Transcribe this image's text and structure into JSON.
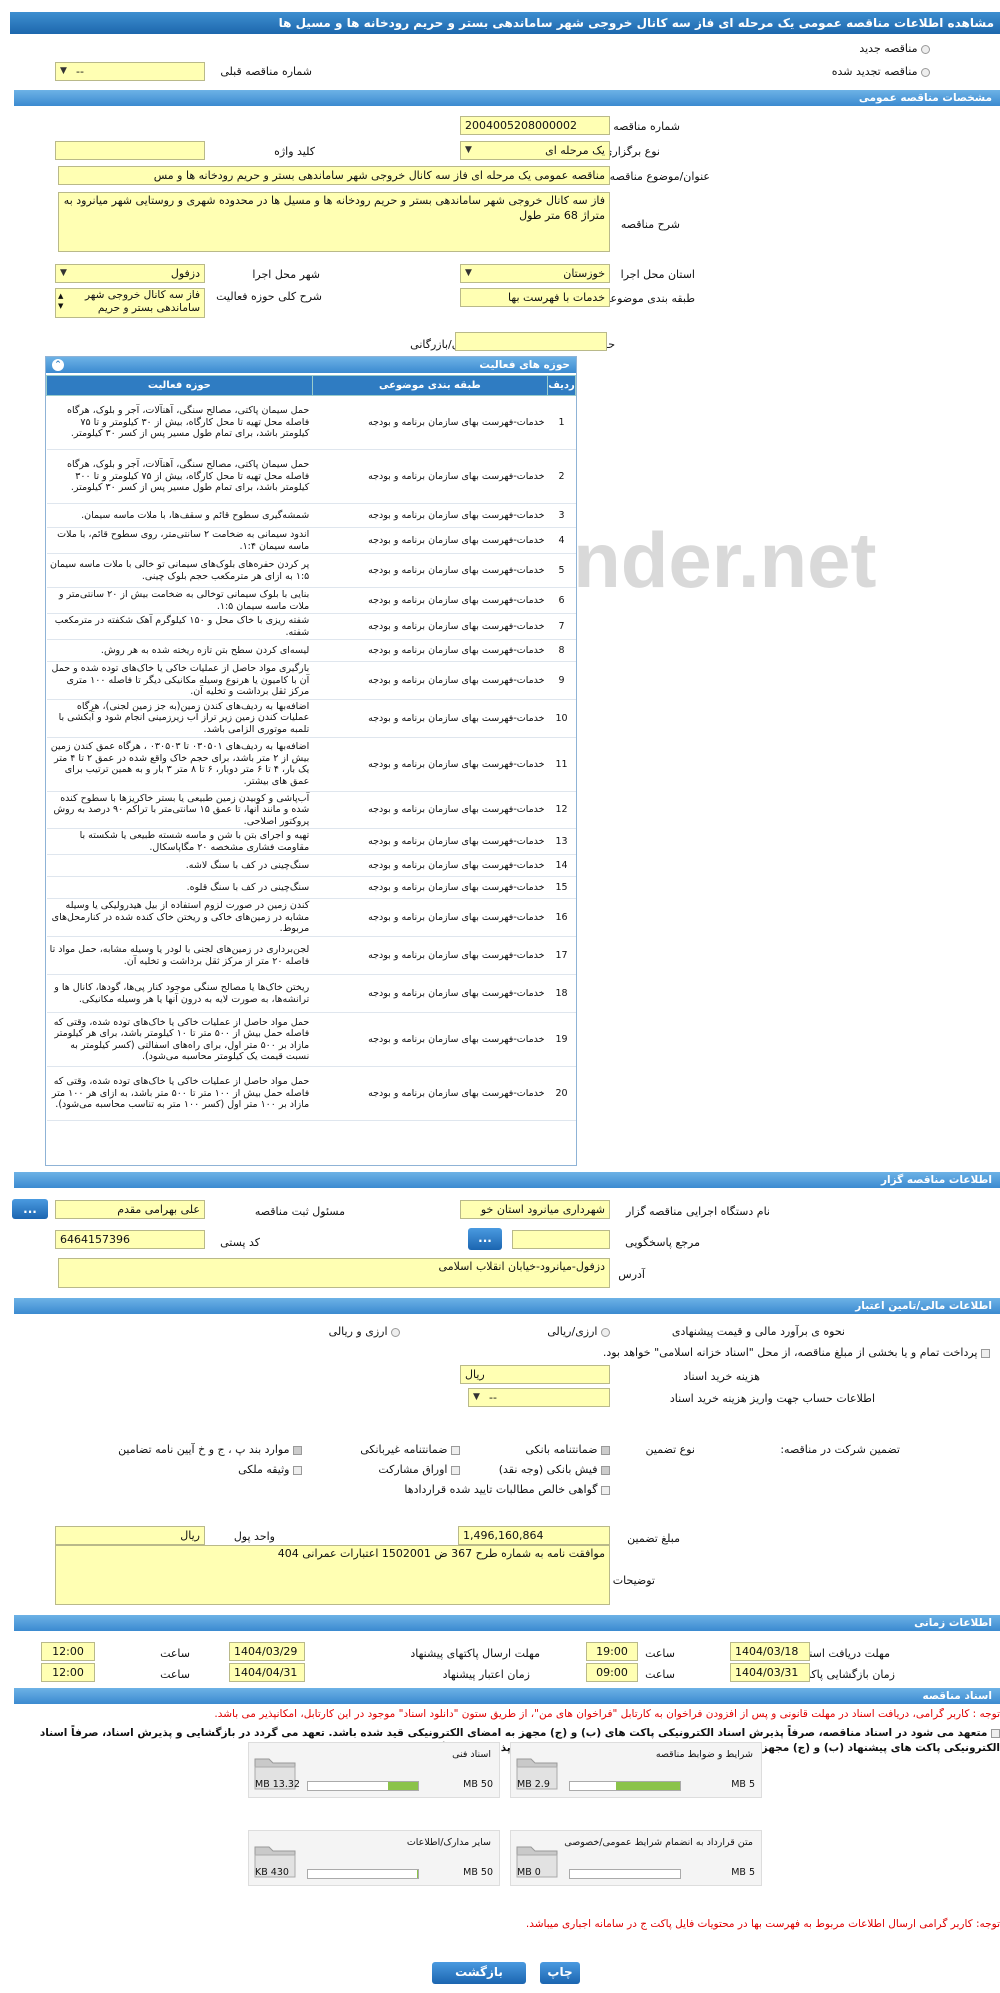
{
  "page": {
    "title": "مشاهده اطلاعات مناقصه عمومی یک مرحله ای فاز سه کانال خروجی شهر ساماندهی بستر و حریم رودخانه ها و مسیل ها"
  },
  "type_section": {
    "new": "مناقصه جدید",
    "renew": "مناقصه تجدید شده",
    "prev_number_label": "شماره مناقصه قبلی",
    "prev_number_value": "--"
  },
  "general": {
    "header": "مشخصات مناقصه عمومی",
    "number_label": "شماره مناقصه",
    "number": "2004005208000002",
    "hold_type_label": "نوع برگزاری",
    "hold_type": "یک مرحله ای",
    "keyword_label": "کلید واژه",
    "keyword": "",
    "subject_label": "عنوان/موضوع مناقصه",
    "subject": "مناقصه عمومی یک مرحله ای فاز سه کانال خروجی شهر ساماندهی بستر و حریم رودخانه ها و مس",
    "desc_label": "شرح مناقصه",
    "desc": "فاز سه کانال خروجی شهر ساماندهی بستر و حریم رودخانه ها و مسیل ها در محدوده شهری و روستایی شهر میانرود به متراژ 68 متر طول",
    "province_label": "استان محل اجرا",
    "province": "خوزستان",
    "city_label": "شهر محل اجرا",
    "city": "دزفول",
    "category_label": "طبقه بندی موضوعی",
    "category": "خدمات با فهرست بها",
    "activity_desc_label": "شرح کلی حوزه فعالیت",
    "activity_desc": "فاز سه کانال خروجی شهر ساماندهی بستر و حریم",
    "min_score_label": "حداقل امتیاز قابل قبول ارزیابی فنی/بازرگانی",
    "min_score": ""
  },
  "activities": {
    "header": "حوزه های فعالیت",
    "col_no": "ردیف",
    "col_cat": "طبقه بندی موضوعی",
    "col_act": "حوزه فعالیت",
    "cat": "خدمات-فهرست بهای سازمان برنامه و بودجه",
    "rows": [
      {
        "n": "1",
        "d": "حمل سیمان پاکتی، مصالح سنگی، آهنآلات، آجر و بلوک، هرگاه فاصله محل تهیه تا محل کارگاه، بیش از ۳۰ کیلومتر و تا ۷۵ کیلومتر باشد، برای تمام طول مسیر پس از کسر ۳۰ کیلومتر."
      },
      {
        "n": "2",
        "d": "حمل سیمان پاکتی، مصالح سنگی، آهنآلات، آجر و بلوک، هرگاه فاصله محل تهیه تا محل کارگاه، بیش از ۷۵ کیلومتر و تا ۳۰۰ کیلومتر باشد، برای تمام طول مسیر پس از کسر ۳۰ کیلومتر."
      },
      {
        "n": "3",
        "d": "شمشه‌گیری سطوح قائم و سقف‌ها، با ملات ماسه سیمان."
      },
      {
        "n": "4",
        "d": "اندود سیمانی به ضخامت ۲ سانتی‌متر، روی سطوح قائم، با ملات ماسه سیمان ۱:۴."
      },
      {
        "n": "5",
        "d": "پر کردن حفره‌های بلوک‌های سیمانی تو خالی با ملات ماسه سیمان ۱:۵ به ازای هر مترمکعب حجم بلوک چینی."
      },
      {
        "n": "6",
        "d": "بنایی با بلوک سیمانی توخالی به ضخامت بیش از ۲۰ سانتی‌متر و ملات ماسه سیمان ۱:۵."
      },
      {
        "n": "7",
        "d": "شفته ریزی با خاک محل و ۱۵۰ کیلوگرم آهک شکفته در مترمکعب شفته."
      },
      {
        "n": "8",
        "d": "لیسه‌ای کردن سطح بتن تازه ریخته شده به هر روش."
      },
      {
        "n": "9",
        "d": "بارگیری مواد حاصل از عملیات خاکی یا خاک‌های توده شده و حمل آن با کامیون یا هرنوع وسیله مکانیکی دیگر تا فاصله ۱۰۰ متری مرکز ثقل برداشت و تخلیه آن."
      },
      {
        "n": "10",
        "d": "اضافه‌بها به ردیف‌های کندن زمین(به جز زمین لجنی)، هرگاه عملیات کندن زمین زیر تراز آب زیرزمینی انجام شود و آبکشی با تلمبه موتوری الزامی باشد."
      },
      {
        "n": "11",
        "d": "اضافه‌بها به ردیف‌های ۰۳۰۵۰۱ تا ۰۳۰۵۰۳ ، هرگاه عمق کندن زمین بیش از ۲ متر باشد، برای حجم خاک واقع شده در عمق ۲ تا ۴ متر یک بار، ۴ تا ۶ متر دوبار، ۶ تا ۸ متر ۳ بار و به همین ترتیب برای عمق های بیشتر."
      },
      {
        "n": "12",
        "d": "آب‌پاشی و کوبیدن زمین طبیعی یا بستر خاکریزها با سطوح کنده شده و مانند آنها، تا عمق ۱۵ سانتی‌متر با تراکم ۹۰ درصد به روش پروکتور اصلاحی."
      },
      {
        "n": "13",
        "d": "تهیه و اجرای بتن با شن و ماسه شسته طبیعی یا شکسته با مقاومت فشاری مشخصه ۲۰ مگاپاسکال."
      },
      {
        "n": "14",
        "d": "سنگ‌چینی در کف با سنگ لاشه."
      },
      {
        "n": "15",
        "d": "سنگ‌چینی در کف با سنگ قلوه."
      },
      {
        "n": "16",
        "d": "کندن زمین در صورت لزوم استفاده از بیل هیدرولیکی یا وسیله مشابه در زمین‌های خاکی و ریختن خاک کنده شده در کنارمحل‌های مربوط."
      },
      {
        "n": "17",
        "d": "لجن‌برداری در زمین‌های لجنی با لودر یا وسیله مشابه، حمل مواد تا فاصله ۲۰ متر از مرکز ثقل برداشت و تخلیه آن."
      },
      {
        "n": "18",
        "d": "ریختن خاک‌ها یا مصالح سنگی موجود کنار پی‌ها، گودها، کانال ها و ترانشه‌ها، به صورت لایه به درون آنها یا هر وسیله مکانیکی."
      },
      {
        "n": "19",
        "d": "حمل مواد حاصل از عملیات خاکی یا خاک‌های توده شده، وقتی که فاصله حمل بیش از ۵۰۰ متر تا ۱۰ کیلومتر باشد، برای هر کیلومتر مازاد بر ۵۰۰ متر اول، برای راه‌های اسفالتی (کسر کیلومتر به نسبت قیمت یک کیلومتر محاسبه می‌شود)."
      },
      {
        "n": "20",
        "d": "حمل مواد حاصل از عملیات خاکی یا خاک‌های توده شده، وقتی که فاصله حمل بیش از ۱۰۰ متر تا ۵۰۰ متر باشد، به ازای هر ۱۰۰ متر مازاد بر ۱۰۰ متر اول (کسر ۱۰۰ متر به تناسب محاسبه می‌شود)."
      }
    ]
  },
  "tenderer": {
    "header": "اطلاعات مناقصه گزار",
    "org_label": "نام دستگاه اجرایی مناقصه گزار",
    "org": "شهرداری میانرود استان خو",
    "resp_label": "مسئول ثبت مناقصه",
    "resp": "علی بهرامی مقدم",
    "ref_label": "مرجع پاسخگویی",
    "ref": "",
    "postal_label": "کد پستی",
    "postal": "6464157396",
    "address_label": "آدرس",
    "address": "دزفول-میانرود-خیابان انقلاب اسلامی",
    "more": "...",
    "more2": "..."
  },
  "finance": {
    "header": "اطلاعات مالی/تامین اعتبار",
    "method_label": "نحوه ی برآورد مالی و قیمت پیشنهادی",
    "opt1": "ارزی/ریالی",
    "opt2": "ارزی و ریالی",
    "treasury": "پرداخت تمام و یا بخشی از مبلغ مناقصه، از محل \"اسناد خزانه اسلامی\" خواهد بود.",
    "doc_cost_label": "هزینه خرید اسناد",
    "doc_cost_unit": "ریال",
    "acct_label": "اطلاعات حساب جهت واریز هزینه خرید اسناد",
    "acct": "--",
    "guarantee_label": "تضمین شرکت در مناقصه:",
    "gtype_label": "نوع تضمین",
    "g1": "ضمانتنامه بانکی",
    "g2": "ضمانتنامه غیربانکی",
    "g3": "موارد بند پ ، ج و خ آیین نامه تضامین",
    "g4": "فیش بانکی (وجه نقد)",
    "g5": "اوراق مشارکت",
    "g6": "وثیقه ملکی",
    "g7": "گواهی خالص مطالبات تایید شده قراردادها",
    "amount_label": "مبلغ تضمین",
    "amount": "1,496,160,864",
    "unit_label": "واحد پول",
    "unit": "ریال",
    "notes_label": "توضیحات",
    "notes": "موافقت نامه به شماره طرح 367 ض 1502001 اعتبارات عمرانی 404"
  },
  "timing": {
    "header": "اطلاعات زمانی",
    "get_label": "مهلت دریافت اسناد",
    "get_date": "1404/03/18",
    "get_time": "19:00",
    "send_label": "مهلت ارسال پاکتهای پیشنهاد",
    "send_date": "1404/03/29",
    "send_time": "12:00",
    "open_label": "زمان بازگشایی پاکت ها",
    "open_date": "1404/03/31",
    "open_time": "09:00",
    "valid_label": "زمان اعتبار پیشنهاد",
    "valid_date": "1404/04/31",
    "valid_time": "12:00",
    "hour_label": "ساعت"
  },
  "docs": {
    "header": "اسناد مناقصه",
    "note1": "توجه : کاربر گرامی، دریافت اسناد در مهلت قانونی و پس از افزودن فراخوان به کارتابل \"فراخوان های من\"، از طریق ستون \"دانلود اسناد\" موجود در این کارتابل، امکانپذیر می باشد.",
    "note2": "متعهد می شود در اسناد مناقصه، صرفاً پذیرش اسناد الکترونیکی پاکت های (ب) و (ج) مجهز به امضای الکترونیکی قید شده باشد. تعهد می گردد در بازگشایی و پذیرش اسناد، صرفاً اسناد الکترونیکی پاکت های پیشنهاد (ب) و (ج) مجهز به امضای الکترونیکی صاحبان امضای مجاز مورد پذیرش واقع گردد.",
    "items": [
      {
        "title": "شرایط و ضوابط مناقصه",
        "total": "5 MB",
        "used": "2.9 MB",
        "pct": 58
      },
      {
        "title": "اسناد فنی",
        "total": "50 MB",
        "used": "13.32 MB",
        "pct": 27
      },
      {
        "title": "متن قرارداد به انضمام شرایط عمومی/خصوصی",
        "total": "5 MB",
        "used": "0 MB",
        "pct": 0
      },
      {
        "title": "سایر مدارک/اطلاعات",
        "total": "50 MB",
        "used": "430 KB",
        "pct": 1
      }
    ],
    "note3": "توجه: کاربر گرامی ارسال اطلاعات مربوط به فهرست بها در محتویات فایل پاکت ج در سامانه اجباری میباشد."
  },
  "actions": {
    "print": "چاپ",
    "back": "بازگشت"
  },
  "watermark": "ariatender.net"
}
